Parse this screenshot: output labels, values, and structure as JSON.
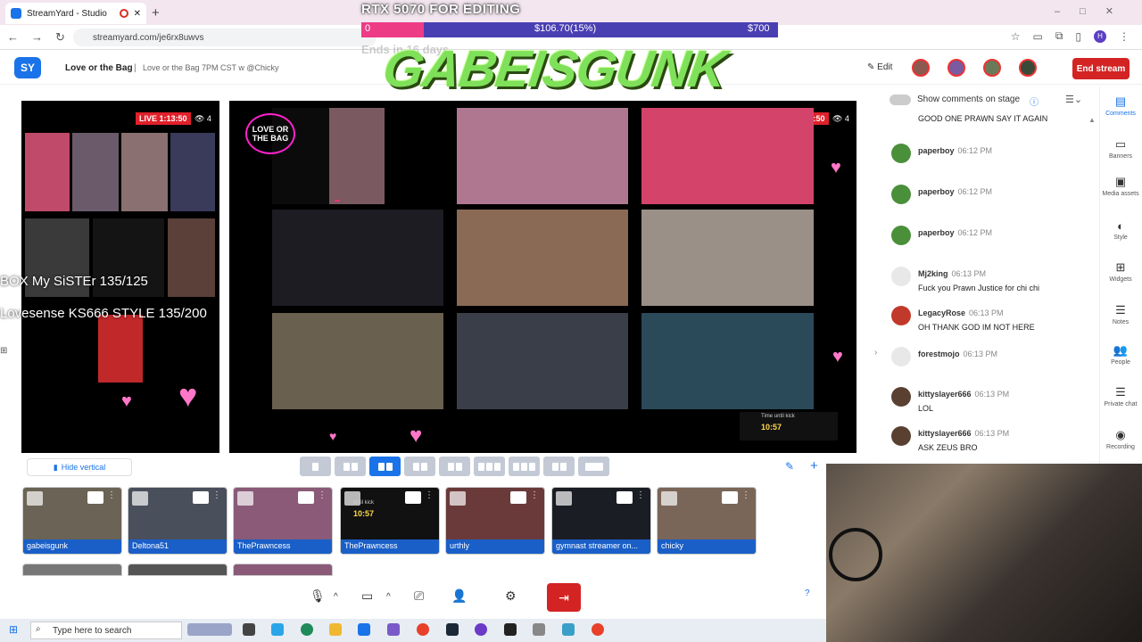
{
  "browser": {
    "tab_title": "StreamYard - Studio",
    "new_tab": "+",
    "url": "streamyard.com/je6rx8uwvs",
    "profile_initial": "H"
  },
  "app": {
    "logo": "SY",
    "broadcast_name": "Love or the Bag",
    "separator": "|",
    "broadcast_title": "Love or the Bag 7PM CST w @Chicky",
    "edit_label": "Edit",
    "end_stream_label": "End stream"
  },
  "donation": {
    "title": "RTX 5070 FOR EDITING",
    "start": "0",
    "current": "$106.70(15%)",
    "goal": "$700",
    "progress_fraction": 0.15,
    "ends": "Ends in 16 days",
    "overlay_name": "GABEISGUNK"
  },
  "stage": {
    "live_left": "LIVE 1:13:50",
    "viewers_left": "4",
    "live_main": "LIVE 1:13:50",
    "viewers_main": "4",
    "logo_text": "LOVE OR THE BAG",
    "overlay_line1": "BOX My SiSTEr 135/125",
    "overlay_line2": "Lovesense KS666 STYLE 135/200",
    "timer_label": "Time until kick",
    "timer_value": "10:57"
  },
  "controls": {
    "hide_vertical": "Hide vertical"
  },
  "participants": [
    {
      "name": "gabeisgunk",
      "color": "#6b6355"
    },
    {
      "name": "Deltona51",
      "color": "#4a4f5c"
    },
    {
      "name": "ThePrawncess",
      "color": "#8a5a78"
    },
    {
      "name": "ThePrawncess",
      "color": "#111111"
    },
    {
      "name": "urthly",
      "color": "#6a3a3a"
    },
    {
      "name": "gymnast streamer on...",
      "color": "#1b1d24"
    },
    {
      "name": "chicky",
      "color": "#7a6658"
    }
  ],
  "tile_timer": {
    "label": "until kick",
    "value": "10:57"
  },
  "comments": {
    "show_label": "Show comments on stage",
    "top_partial": "GOOD ONE PRAWN SAY IT AGAIN",
    "items": [
      {
        "name": "paperboy",
        "time": "06:12 PM",
        "text": "",
        "avatar": "#4a8f3a"
      },
      {
        "name": "paperboy",
        "time": "06:12 PM",
        "text": "",
        "avatar": "#4a8f3a"
      },
      {
        "name": "paperboy",
        "time": "06:12 PM",
        "text": "",
        "avatar": "#4a8f3a"
      },
      {
        "name": "Mj2king",
        "time": "06:13 PM",
        "text": "Fuck you Prawn Justice for chi chi",
        "avatar": "#e8e8e8"
      },
      {
        "name": "LegacyRose",
        "time": "06:13 PM",
        "text": "OH THANK GOD IM NOT HERE",
        "avatar": "#c0392b"
      },
      {
        "name": "forestmojo",
        "time": "06:13 PM",
        "text": "",
        "avatar": "#e8e8e8"
      },
      {
        "name": "kittyslayer666",
        "time": "06:13 PM",
        "text": "LOL",
        "avatar": "#5a4030"
      },
      {
        "name": "kittyslayer666",
        "time": "06:13 PM",
        "text": "ASK ZEUS BRO",
        "avatar": "#5a4030"
      }
    ]
  },
  "rail": [
    {
      "label": "Comments",
      "icon": "comment-icon",
      "glyph": "▤",
      "active": true
    },
    {
      "label": "Banners",
      "icon": "banner-icon",
      "glyph": "▭",
      "active": false
    },
    {
      "label": "Media assets",
      "icon": "media-icon",
      "glyph": "▣",
      "active": false
    },
    {
      "label": "Style",
      "icon": "palette-icon",
      "glyph": "◐",
      "active": false
    },
    {
      "label": "Widgets",
      "icon": "widgets-icon",
      "glyph": "⊞",
      "active": false
    },
    {
      "label": "Notes",
      "icon": "notes-icon",
      "glyph": "☰",
      "active": false
    },
    {
      "label": "People",
      "icon": "people-icon",
      "glyph": "👥",
      "active": false
    },
    {
      "label": "Private chat",
      "icon": "chat-icon",
      "glyph": "☰",
      "active": false
    },
    {
      "label": "Recording",
      "icon": "record-icon",
      "glyph": "◉",
      "active": false
    }
  ],
  "taskbar": {
    "search_placeholder": "Type here to search"
  },
  "colors": {
    "accent": "#1a73e8",
    "end_stream": "#d32323",
    "live": "#e0202a",
    "donation_bar": "#4a3fb2",
    "donation_fill": "#ee3b86"
  }
}
